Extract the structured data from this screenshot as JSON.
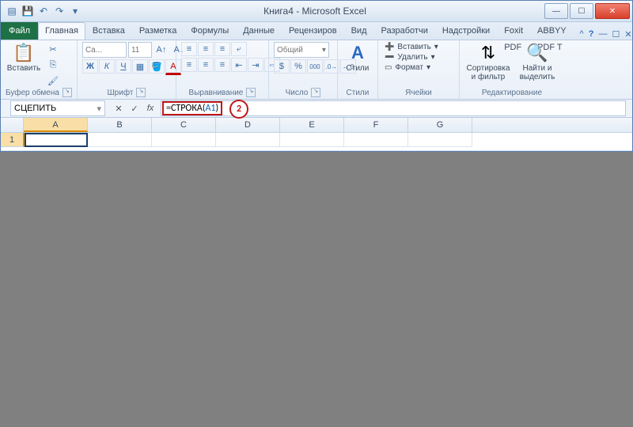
{
  "title": "Книга4 - Microsoft Excel",
  "qat": {
    "save": "💾",
    "undo": "↶",
    "redo": "↷"
  },
  "winbtns": {
    "min": "—",
    "max": "☐",
    "close": "✕"
  },
  "tabs": {
    "file": "Файл",
    "list": [
      "Главная",
      "Вставка",
      "Разметка ст",
      "Формулы",
      "Данные",
      "Рецензиров",
      "Вид",
      "Разработчи",
      "Надстройки",
      "Foxit PDF",
      "ABBYY PDF T"
    ],
    "activeIndex": 0
  },
  "mdi": {
    "help": "?",
    "min": "—",
    "max": "☐",
    "close": "✕"
  },
  "ribbon": {
    "clipboard": {
      "caption": "Буфер обмена",
      "paste": "Вставить",
      "pasteIcon": "📋",
      "cut": "✂",
      "copy": "⎘",
      "painter": "🖌"
    },
    "font": {
      "caption": "Шрифт",
      "nameHint": "Ca...",
      "size": "11",
      "growIcon": "A↑",
      "shrinkIcon": "A↓",
      "bold": "Ж",
      "italic": "К",
      "underline": "Ч",
      "border": "▦",
      "fill": "🪣",
      "color": "A"
    },
    "align": {
      "caption": "Выравнивание",
      "tl": "≡",
      "tc": "≡",
      "tr": "≡",
      "ml": "≡",
      "mc": "≡",
      "mr": "≡",
      "wrap": "⤶",
      "indL": "⇤",
      "indR": "⇥",
      "merge": "⇔"
    },
    "number": {
      "caption": "Число",
      "format": "Общий",
      "cur": "$",
      "pct": "%",
      "comma": "000",
      "inc": ".0→",
      "dec": "←.0"
    },
    "styles": {
      "caption": "Стили",
      "label": "Стили",
      "icon": "A"
    },
    "cells": {
      "caption": "Ячейки",
      "insert": "Вставить",
      "delete": "Удалить",
      "format": "Формат",
      "insIcon": "➕",
      "delIcon": "➖",
      "fmtIcon": "▭"
    },
    "editing": {
      "caption": "Редактирование",
      "sort": "Сортировка и фильтр",
      "find": "Найти и выделить",
      "sortIcon": "⇅",
      "findIcon": "🔍"
    }
  },
  "formulaBar": {
    "nameBox": "СЦЕПИТЬ",
    "cancel": "✕",
    "enter": "✓",
    "fxLabel": "fx",
    "formulaPrefix": "=СТРОКА(",
    "formulaRef": "A1",
    "formulaSuffix": ")",
    "callout": "2"
  },
  "columns": [
    "A",
    "B",
    "C",
    "D",
    "E",
    "F",
    "G"
  ],
  "rowLabel": "1"
}
